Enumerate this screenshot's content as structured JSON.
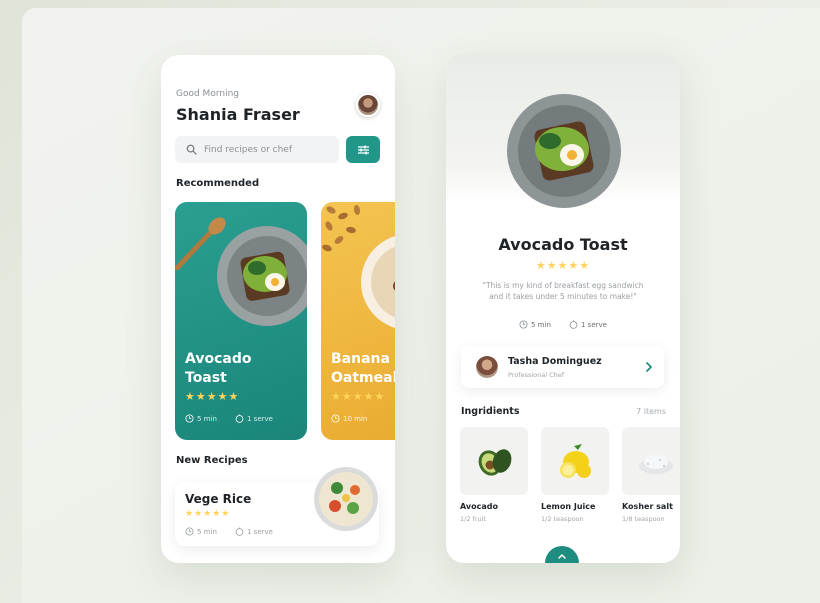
{
  "left": {
    "greeting": "Good Morning",
    "user_name": "Shania Fraser",
    "search": {
      "placeholder": "Find recipes or chef"
    },
    "recommended_title": "Recommended",
    "recommended": [
      {
        "title": "Avocado Toast",
        "stars": "★★★★★",
        "time": "5 min",
        "serve": "1 serve"
      },
      {
        "title": "Banana Oatmeal",
        "stars": "★★★★★",
        "time": "10 min",
        "serve": ""
      }
    ],
    "new_recipes_title": "New Recipes",
    "new_recipe": {
      "title": "Vege Rice",
      "stars": "★★★★★",
      "time": "5 min",
      "serve": "1 serve"
    }
  },
  "right": {
    "dish_title": "Avocado Toast",
    "stars": "★★★★★",
    "quote": "\"This is my kind of breakfast egg sandwich and it takes under 5 minutes to make!\"",
    "time": "5 min",
    "serve": "1 serve",
    "chef": {
      "name": "Tasha Dominguez",
      "role": "Professional Chef"
    },
    "ingredients_title": "Ingridients",
    "ingredients_count": "7 items",
    "ingredients": [
      {
        "name": "Avocado",
        "qty": "1/2 fruit"
      },
      {
        "name": "Lemon Juice",
        "qty": "1/2 teaspoon"
      },
      {
        "name": "Kosher salt",
        "qty": "1/8 teaspoon"
      }
    ]
  },
  "colors": {
    "accent": "#21978a",
    "teal_card": "#1b857a",
    "yellow_card": "#e9aa2f",
    "star": "#ffd35c"
  }
}
